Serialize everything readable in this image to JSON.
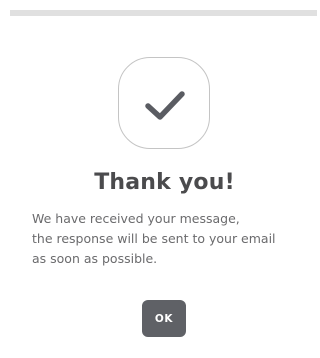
{
  "dialog": {
    "icon": "checkmark-icon",
    "title": "Thank you!",
    "message_lines": [
      "We have received your message,",
      "the response will be sent to your email",
      "as soon as possible."
    ],
    "ok_label": "OK"
  },
  "colors": {
    "title": "#4b4b4d",
    "message": "#6b6b6d",
    "button_bg": "#5f6166",
    "button_text": "#ffffff",
    "badge_border": "#c4c4c4",
    "checkmark": "#5a5c62",
    "top_bar": "#e0e0e0"
  }
}
